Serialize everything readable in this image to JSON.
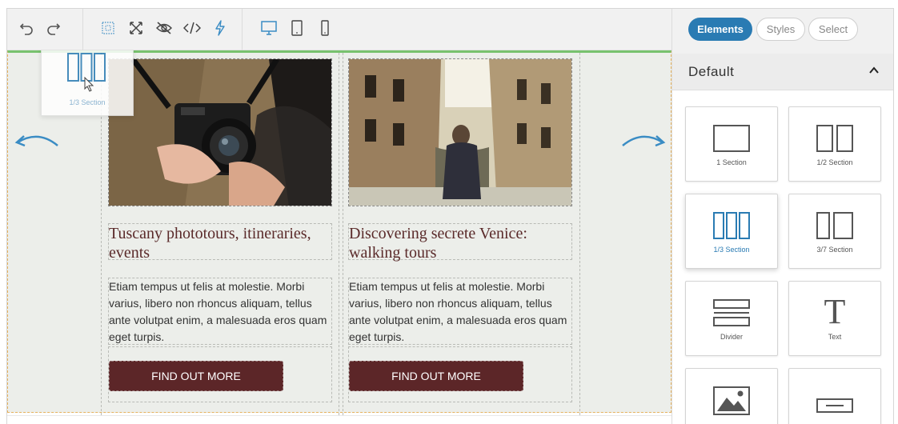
{
  "toolbar": {
    "icons": [
      "undo-icon",
      "redo-icon",
      "select-all-icon",
      "fullscreen-icon",
      "hide-icon",
      "code-icon",
      "lightning-icon",
      "desktop-icon",
      "tablet-icon",
      "mobile-icon"
    ]
  },
  "panel": {
    "tabs": [
      {
        "label": "Elements",
        "active": true
      },
      {
        "label": "Styles",
        "active": false
      },
      {
        "label": "Select",
        "active": false
      }
    ],
    "section_title": "Default",
    "elements": [
      {
        "label": "1 Section",
        "icon": "one-section-icon"
      },
      {
        "label": "1/2 Section",
        "icon": "half-section-icon"
      },
      {
        "label": "1/3 Section",
        "icon": "third-section-icon",
        "selected": true
      },
      {
        "label": "3/7 Section",
        "icon": "three-seven-section-icon"
      },
      {
        "label": "Divider",
        "icon": "divider-icon"
      },
      {
        "label": "Text",
        "icon": "text-icon"
      },
      {
        "label": "",
        "icon": "image-icon"
      },
      {
        "label": "",
        "icon": "button-icon"
      }
    ]
  },
  "drag_ghost": {
    "label": "1/3 Section"
  },
  "canvas": {
    "cards": [
      {
        "title": "Tuscany phototours, itineraries, events",
        "body": "Etiam tempus ut felis at molestie. Morbi varius, libero non rhoncus aliquam, tellus ante volutpat enim, a malesuada eros quam eget turpis.",
        "button": "FIND OUT MORE",
        "image": "camera-photo"
      },
      {
        "title": "Discovering secrete Venice: walking tours",
        "body": "Etiam tempus ut felis at molestie. Morbi varius, libero non rhoncus aliquam, tellus ante volutpat enim, a malesuada eros quam eget turpis.",
        "button": "FIND OUT MORE",
        "image": "venice-street-photo"
      }
    ]
  },
  "colors": {
    "accent": "#2a7bb3",
    "button_bg": "#5c2628",
    "title_color": "#5a2a2a",
    "drop_highlight": "#78c26e"
  }
}
